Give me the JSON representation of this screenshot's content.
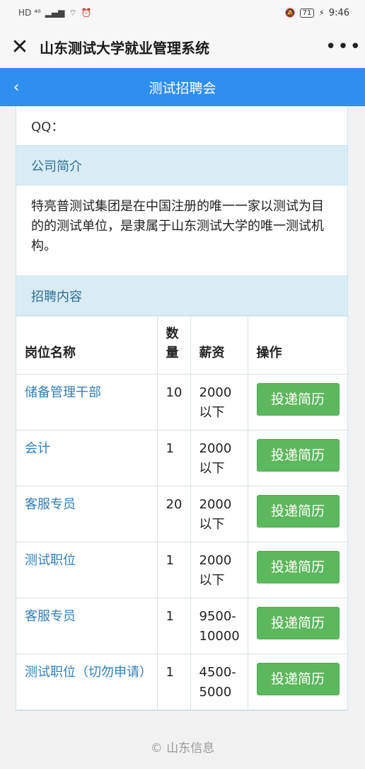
{
  "status_bar": {
    "left_text": "HD ⁴⁶",
    "battery": "71",
    "time": "9:46"
  },
  "title_bar": {
    "close_symbol": "✕",
    "title": "山东测试大学就业管理系统",
    "more_symbol": "•••"
  },
  "nav": {
    "back_symbol": "‹",
    "title": "测试招聘会"
  },
  "company": {
    "qq_label": "QQ：",
    "intro_heading": "公司简介",
    "intro_text": "特亮普测试集团是在中国注册的唯一一家以测试为目的的测试单位，是隶属于山东测试大学的唯一测试机构。",
    "jobs_heading": "招聘内容"
  },
  "jobs_table": {
    "headers": [
      "岗位名称",
      "数量",
      "薪资",
      "操作"
    ],
    "rows": [
      {
        "position": "储备管理干部",
        "count": "10",
        "salary": "2000以下",
        "action": "投递简历"
      },
      {
        "position": "会计",
        "count": "1",
        "salary": "2000以下",
        "action": "投递简历"
      },
      {
        "position": "客服专员",
        "count": "20",
        "salary": "2000以下",
        "action": "投递简历"
      },
      {
        "position": "测试职位",
        "count": "1",
        "salary": "2000以下",
        "action": "投递简历"
      },
      {
        "position": "客服专员",
        "count": "1",
        "salary": "9500-10000",
        "action": "投递简历"
      },
      {
        "position": "测试职位（切勿申请）",
        "count": "1",
        "salary": "4500-5000",
        "action": "投递简历"
      }
    ]
  },
  "footer": "© 山东信息",
  "colors": {
    "nav_blue": "#2f8ff1",
    "section_bg": "#d9ecf5",
    "link": "#2f7fb7",
    "button_green": "#5cb85c"
  }
}
